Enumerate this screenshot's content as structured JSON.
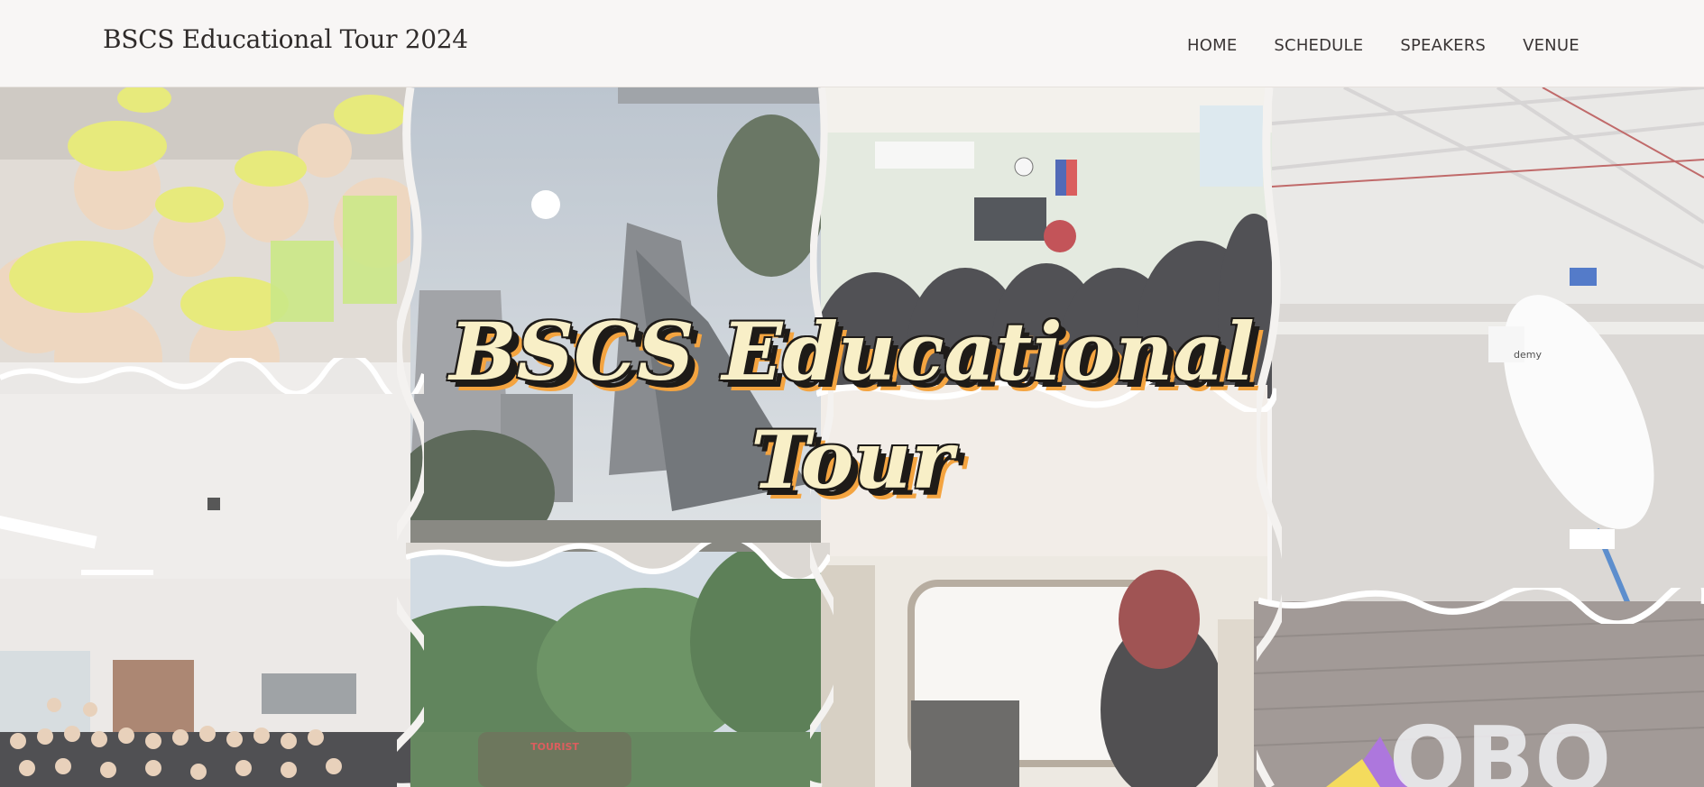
{
  "header": {
    "brand": "BSCS Educational Tour 2024",
    "nav": [
      "HOME",
      "SCHEDULE",
      "SPEAKERS",
      "VENUE"
    ]
  },
  "hero": {
    "line1": "BSCS Educational",
    "line2": "Tour"
  },
  "photos": {
    "bus_sign": "TOURIST",
    "hangar_sign": "demy",
    "mural_letters": "OBO"
  },
  "colors": {
    "title_fill": "#f8efc7",
    "title_outline": "#1e1b18",
    "title_shadow": "#f4a440"
  }
}
